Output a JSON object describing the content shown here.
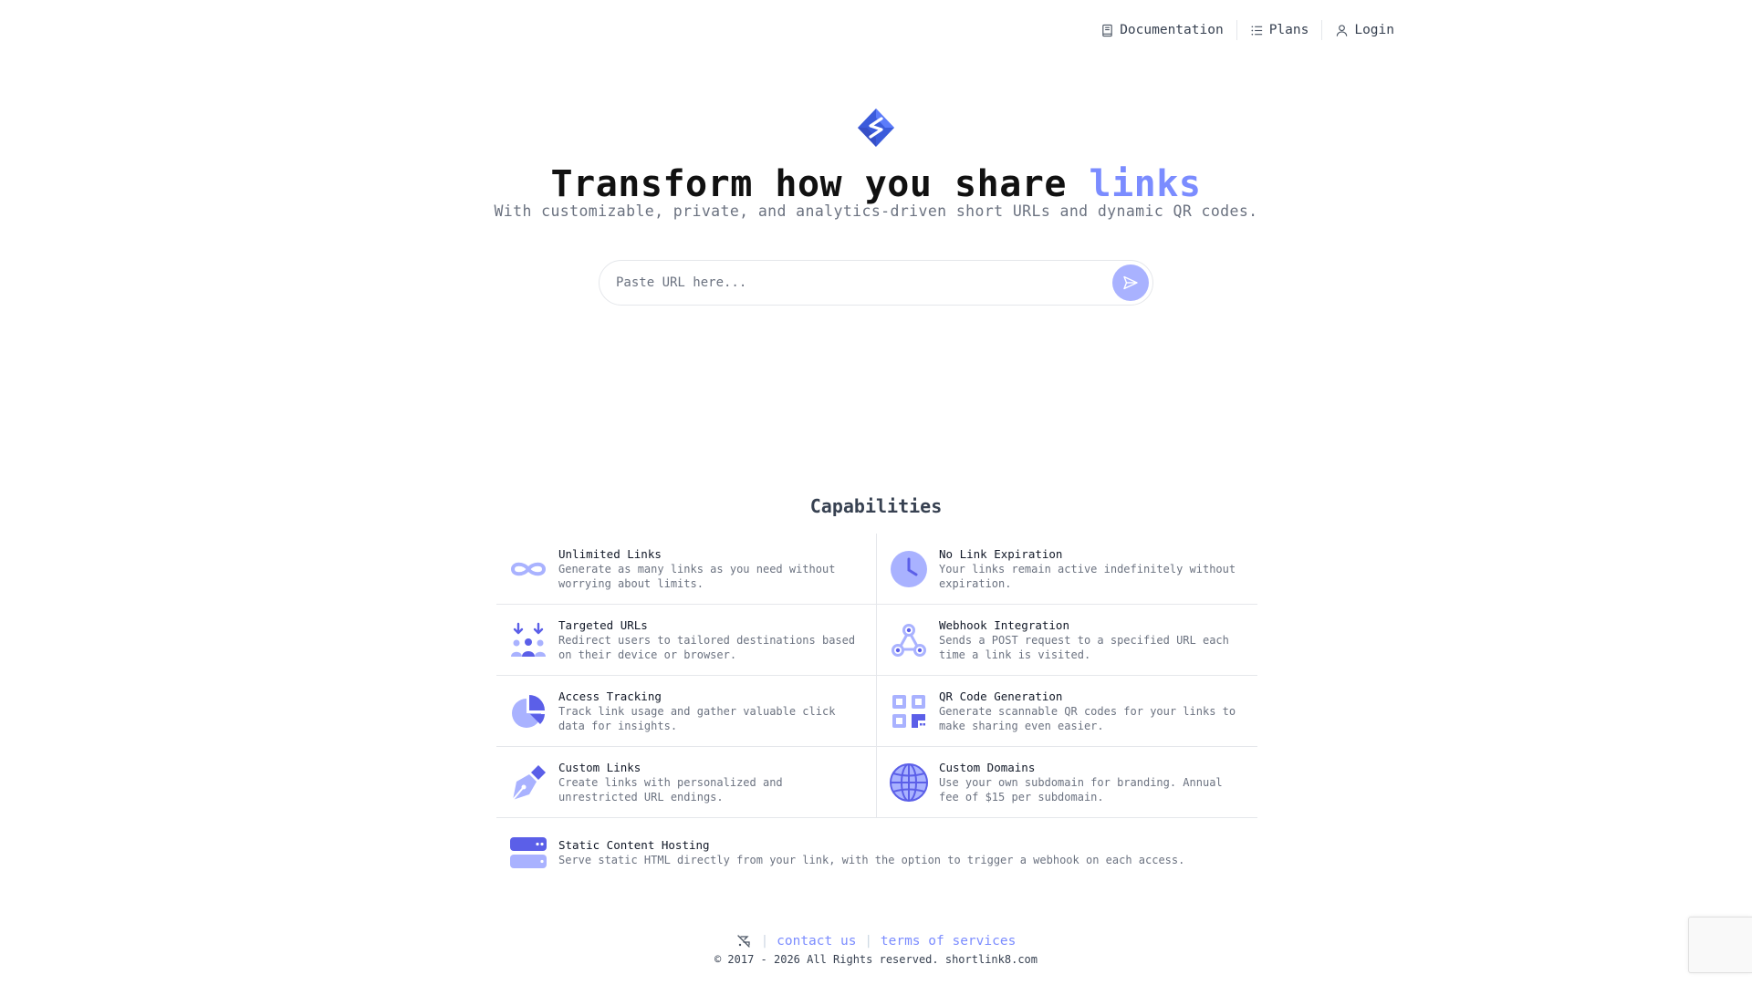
{
  "nav": {
    "documentation": "Documentation",
    "plans": "Plans",
    "login": "Login"
  },
  "hero": {
    "title_main": "Transform how you share ",
    "title_accent": "links",
    "subtitle": "With customizable, private, and analytics-driven short URLs and dynamic QR codes."
  },
  "url_input": {
    "placeholder": "Paste URL here...",
    "value": ""
  },
  "capabilities": {
    "title": "Capabilities",
    "items": [
      {
        "name": "Unlimited Links",
        "desc": "Generate as many links as you need without worrying about limits.",
        "icon": "infinity-icon"
      },
      {
        "name": "No Link Expiration",
        "desc": "Your links remain active indefinitely without expiration.",
        "icon": "clock-icon"
      },
      {
        "name": "Targeted URLs",
        "desc": "Redirect users to tailored destinations based on their device or browser.",
        "icon": "users-target-icon"
      },
      {
        "name": "Webhook Integration",
        "desc": "Sends a POST request to a specified URL each time a link is visited.",
        "icon": "webhook-icon"
      },
      {
        "name": "Access Tracking",
        "desc": "Track link usage and gather valuable click data for insights.",
        "icon": "pie-chart-icon"
      },
      {
        "name": "QR Code Generation",
        "desc": "Generate scannable QR codes for your links to make sharing even easier.",
        "icon": "qr-code-icon"
      },
      {
        "name": "Custom Links",
        "desc": "Create links with personalized and unrestricted URL endings.",
        "icon": "pen-nib-icon"
      },
      {
        "name": "Custom Domains",
        "desc": "Use your own subdomain for branding. Annual fee of $15 per subdomain.",
        "icon": "globe-icon"
      },
      {
        "name": "Static Content Hosting",
        "desc": "Serve static HTML directly from your link, with the option to trigger a webhook on each access.",
        "icon": "server-icon"
      }
    ]
  },
  "footer": {
    "contact": "contact us",
    "terms": "terms of services",
    "separator": "|",
    "copyright": "© 2017 - 2026 All Rights reserved. shortlink8.com"
  },
  "colors": {
    "accent": "#7b8cff",
    "icon_primary": "#5b5fe8",
    "icon_light": "#a9b2ff"
  }
}
